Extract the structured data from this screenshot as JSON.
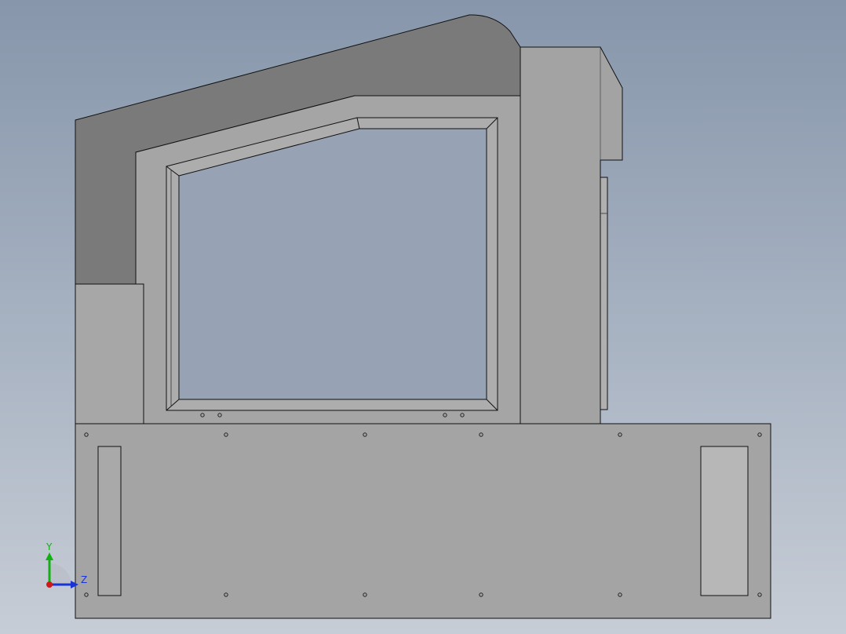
{
  "viewport": {
    "background_top": "#8796ab",
    "background_bottom": "#c7cdd6"
  },
  "model": {
    "colors": {
      "dark_shell": "#7a7a7a",
      "panel": "#a7a7a7",
      "panel_light": "#bcbcbc",
      "edge": "#111111"
    }
  },
  "triad": {
    "y_label": "Y",
    "z_label": "Z",
    "y_color": "#12b012",
    "z_color": "#1a33d6",
    "origin_color": "#d01818"
  }
}
